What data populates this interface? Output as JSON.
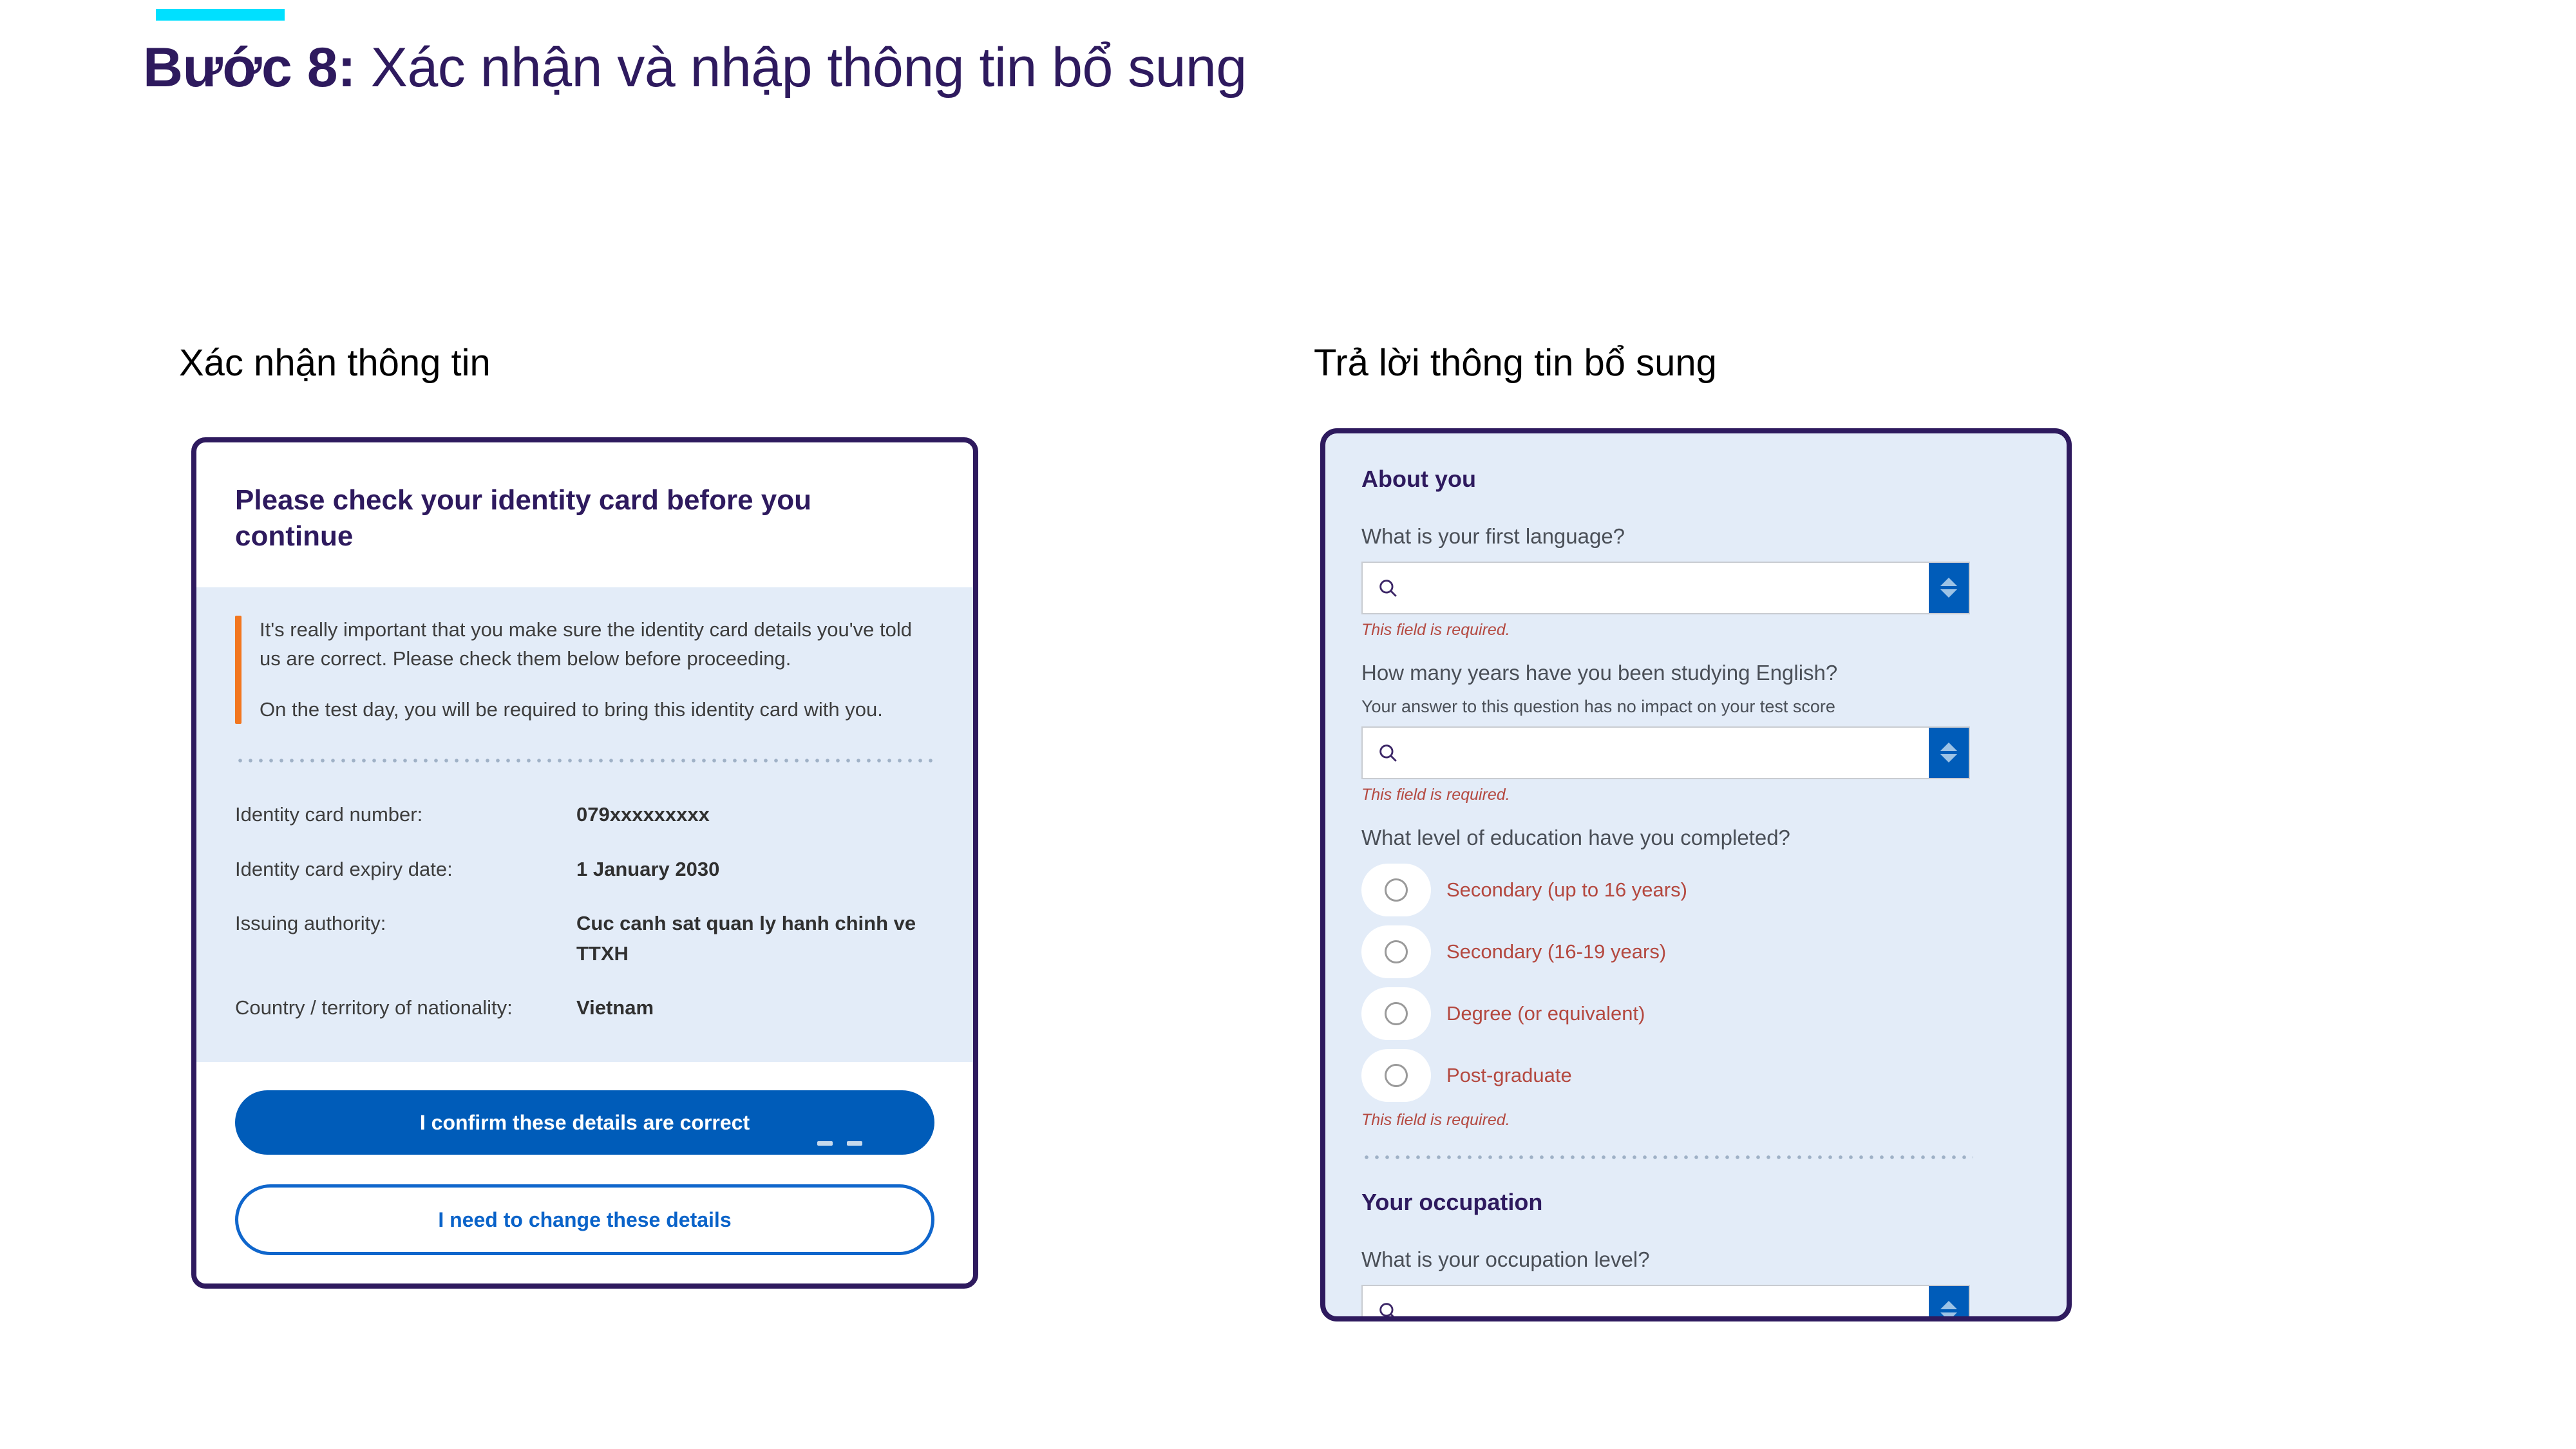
{
  "slide": {
    "accent_color": "#00e0ff",
    "title_color": "#2e1a5e",
    "title_step": "Bước 8:",
    "title_rest": " Xác nhận và nhập thông tin bổ sung"
  },
  "columns": {
    "left_heading": "Xác nhận thông tin",
    "right_heading": "Trả lời thông tin bổ sung"
  },
  "identity_card": {
    "title": "Please check your identity card before you continue",
    "notice": {
      "accent_color": "#f2761f",
      "paragraphs": [
        "It's really important that you make sure the identity card details you've told us are correct. Please check them below before proceeding.",
        "On the test day, you will be required to bring this identity card with you."
      ]
    },
    "details": [
      {
        "label": "Identity card number:",
        "value": "079xxxxxxxxx"
      },
      {
        "label": "Identity card expiry date:",
        "value": "1 January 2030"
      },
      {
        "label": "Issuing authority:",
        "value": "Cuc canh sat quan ly hanh chinh ve TTXH"
      },
      {
        "label": "Country / territory of nationality:",
        "value": "Vietnam"
      }
    ],
    "primary_button": "I confirm these details are correct",
    "secondary_button": "I need to change these details",
    "primary_color": "#005cb9",
    "secondary_color": "#0a63c9"
  },
  "additional_info": {
    "section_about": "About you",
    "section_occupation": "Your occupation",
    "required_error": "This field is required.",
    "search_icon": "search-icon",
    "stepper_icon": "updown-stepper-icon",
    "radio_icon": "radio-unchecked-icon",
    "q_first_language": {
      "label": "What is your first language?",
      "value": "",
      "placeholder": ""
    },
    "q_years_english": {
      "label": "How many years have you been studying English?",
      "hint": "Your answer to this question has no impact on your test score",
      "value": "",
      "placeholder": ""
    },
    "q_education": {
      "label": "What level of education have you completed?",
      "options": [
        "Secondary (up to 16 years)",
        "Secondary (16-19 years)",
        "Degree (or equivalent)",
        "Post-graduate"
      ]
    },
    "q_occupation": {
      "label": "What is your occupation level?",
      "value": "",
      "placeholder": ""
    }
  }
}
